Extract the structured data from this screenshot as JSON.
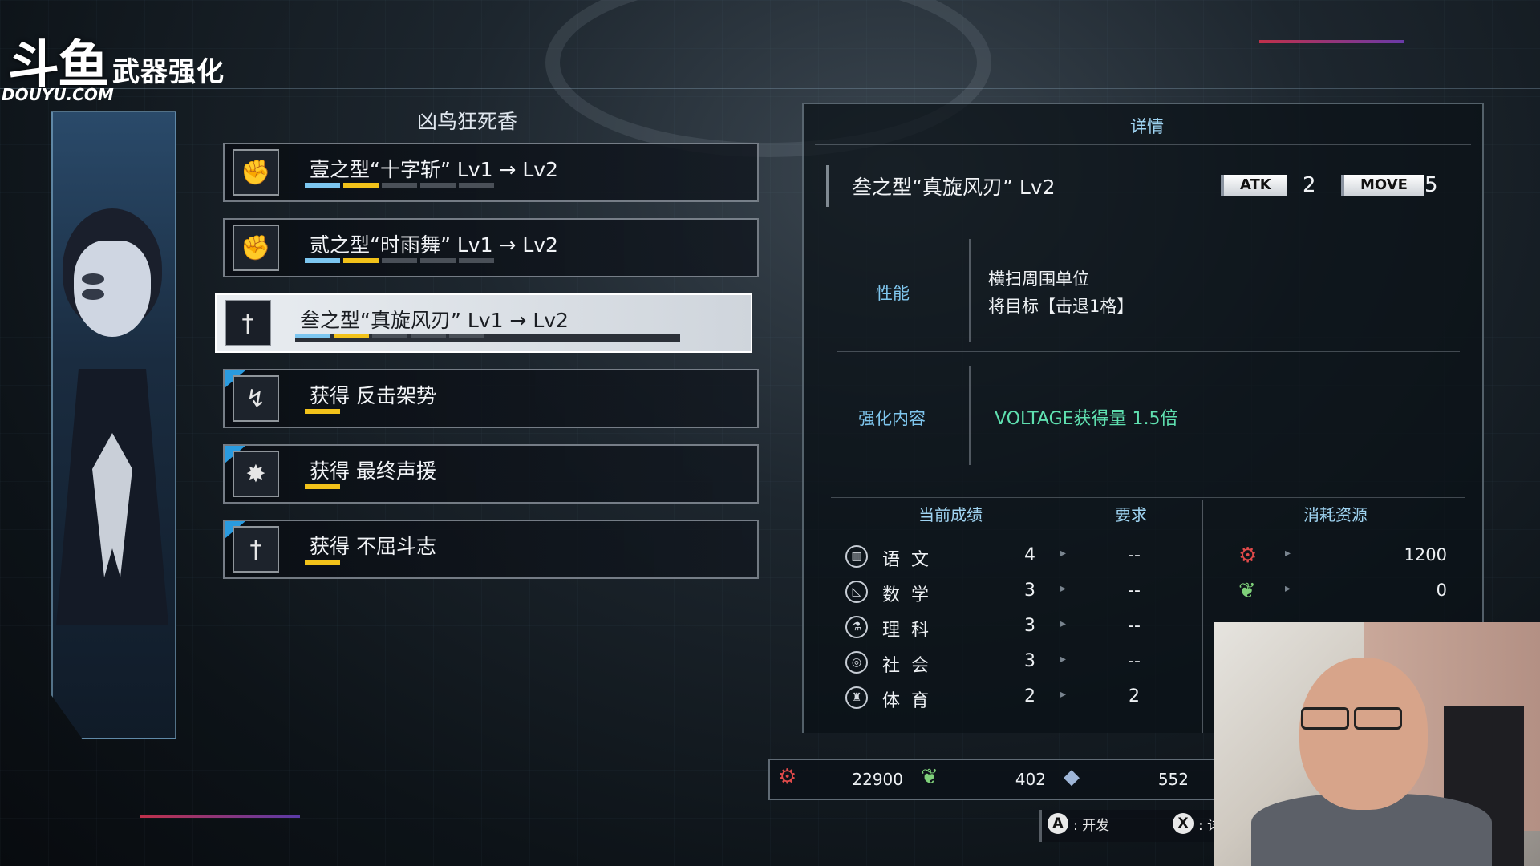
{
  "watermark": {
    "brand": "斗鱼",
    "site": "DOUYU.COM"
  },
  "header": {
    "title": "武器强化"
  },
  "weapon": {
    "name": "凶鸟狂死香"
  },
  "skills": [
    {
      "label": "壹之型“十字斩” Lv1 → Lv2",
      "icon": "fist-icon",
      "bars": [
        "b",
        "y",
        "g",
        "g",
        "g"
      ],
      "selected": false,
      "new": false
    },
    {
      "label": "贰之型“时雨舞” Lv1 → Lv2",
      "icon": "fist-icon",
      "bars": [
        "b",
        "y",
        "g",
        "g",
        "g"
      ],
      "selected": false,
      "new": false
    },
    {
      "label": "叁之型“真旋风刃” Lv1 → Lv2",
      "icon": "blade-icon",
      "bars": [
        "b",
        "y",
        "g",
        "g",
        "g"
      ],
      "selected": true,
      "new": false
    },
    {
      "label": "获得 反击架势",
      "icon": "counter-icon",
      "bars": [
        "y"
      ],
      "selected": false,
      "new": true
    },
    {
      "label": "获得 最终声援",
      "icon": "burst-icon",
      "bars": [
        "y"
      ],
      "selected": false,
      "new": true
    },
    {
      "label": "获得 不屈斗志",
      "icon": "blade-icon",
      "bars": [
        "y"
      ],
      "selected": false,
      "new": true
    }
  ],
  "detail": {
    "title": "详情",
    "skill_name": "叁之型“真旋风刃” Lv2",
    "atk_label": "ATK",
    "atk_value": "2",
    "move_label": "MOVE",
    "move_value": "5",
    "performance_label": "性能",
    "performance_lines": [
      "横扫周围单位",
      "将目标【击退1格】"
    ],
    "enhance_label": "强化内容",
    "enhance_text": "VOLTAGE获得量 1.5倍"
  },
  "table": {
    "col_current": "当前成绩",
    "col_require": "要求",
    "col_cost": "消耗资源",
    "subjects": [
      {
        "name": "语文",
        "value": "4",
        "require": "--",
        "icon": "book-icon"
      },
      {
        "name": "数学",
        "value": "3",
        "require": "--",
        "icon": "ruler-icon"
      },
      {
        "name": "理科",
        "value": "3",
        "require": "--",
        "icon": "flask-icon"
      },
      {
        "name": "社会",
        "value": "3",
        "require": "--",
        "icon": "globe-icon"
      },
      {
        "name": "体育",
        "value": "2",
        "require": "2",
        "icon": "sport-icon"
      }
    ],
    "costs": [
      {
        "icon": "gear-coin-icon",
        "value": "1200"
      },
      {
        "icon": "leaf-icon",
        "value": "0"
      }
    ]
  },
  "resources": [
    {
      "icon": "gear-coin-icon",
      "value": "22900"
    },
    {
      "icon": "leaf-icon",
      "value": "402"
    },
    {
      "icon": "crystal-icon",
      "value": "552"
    }
  ],
  "controls": [
    {
      "key": "A",
      "label": ": 开发"
    },
    {
      "key": "X",
      "label": ": 详"
    }
  ],
  "colors": {
    "accent_blue": "#7cc6f0",
    "accent_yellow": "#f2c21a",
    "enhance_green": "#5fe0b0",
    "label_blue": "#7fc6ee"
  }
}
